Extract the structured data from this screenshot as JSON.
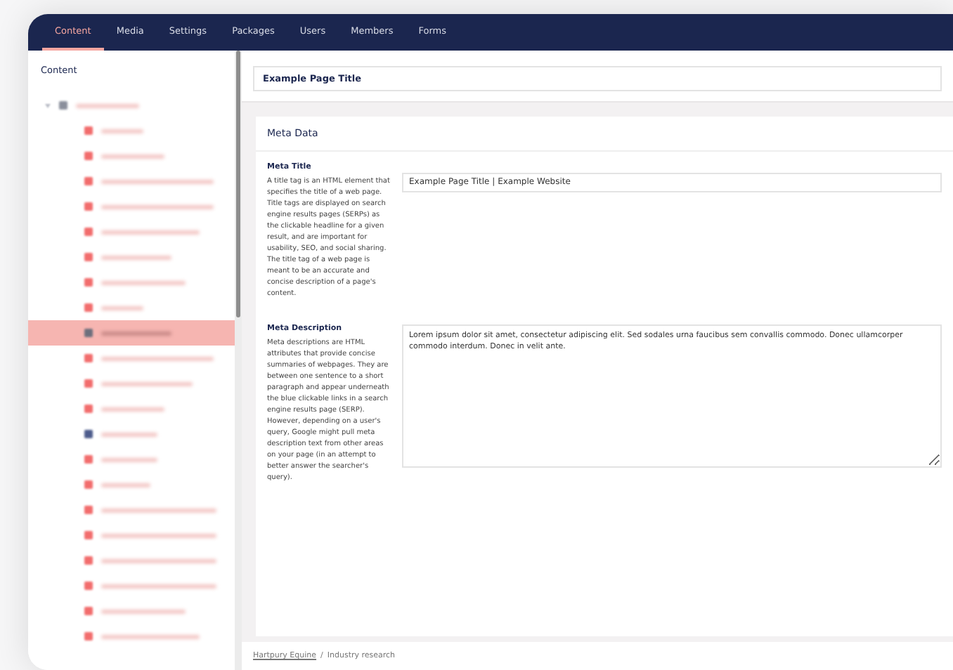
{
  "top_nav": {
    "tabs": [
      {
        "label": "Content",
        "selected": true
      },
      {
        "label": "Media",
        "selected": false
      },
      {
        "label": "Settings",
        "selected": false
      },
      {
        "label": "Packages",
        "selected": false
      },
      {
        "label": "Users",
        "selected": false
      },
      {
        "label": "Members",
        "selected": false
      },
      {
        "label": "Forms",
        "selected": false
      }
    ]
  },
  "sidebar": {
    "title": "Content",
    "root": {
      "expanded": true,
      "color": "#8a8f9c"
    },
    "items": [
      {
        "color": "#f26d6d",
        "selected": false
      },
      {
        "color": "#f26d6d",
        "selected": false
      },
      {
        "color": "#f26d6d",
        "selected": false
      },
      {
        "color": "#f26d6d",
        "selected": false
      },
      {
        "color": "#f26d6d",
        "selected": false
      },
      {
        "color": "#f26d6d",
        "selected": false
      },
      {
        "color": "#f26d6d",
        "selected": false
      },
      {
        "color": "#f26d6d",
        "selected": false
      },
      {
        "color": "#6d6f7d",
        "selected": true
      },
      {
        "color": "#f26d6d",
        "selected": false
      },
      {
        "color": "#f26d6d",
        "selected": false
      },
      {
        "color": "#f26d6d",
        "selected": false
      },
      {
        "color": "#4d5c8c",
        "selected": false
      },
      {
        "color": "#f26d6d",
        "selected": false
      },
      {
        "color": "#f26d6d",
        "selected": false
      },
      {
        "color": "#f26d6d",
        "selected": false
      },
      {
        "color": "#f26d6d",
        "selected": false
      },
      {
        "color": "#f26d6d",
        "selected": false
      },
      {
        "color": "#f26d6d",
        "selected": false
      },
      {
        "color": "#f26d6d",
        "selected": false
      },
      {
        "color": "#f26d6d",
        "selected": false
      }
    ]
  },
  "editor": {
    "page_title": "Example Page Title",
    "panel_title": "Meta Data",
    "properties": [
      {
        "kind": "input",
        "label": "Meta Title",
        "description": "A title tag is an HTML element that specifies the title of a web page. Title tags are displayed on search engine results pages (SERPs) as the clickable headline for a given result, and are important for usability, SEO, and social sharing. The title tag of a web page is meant to be an accurate and concise description of a page's content.",
        "value": "Example Page Title | Example Website"
      },
      {
        "kind": "textarea",
        "label": "Meta Description",
        "description": "Meta descriptions are HTML attributes that provide concise summaries of webpages. They are between one sentence to a short paragraph and appear underneath the blue clickable links in a search engine results page (SERP). However, depending on a user's query, Google might pull meta description text from other areas on your page (in an attempt to better answer the searcher's query).",
        "value": "Lorem ipsum dolor sit amet, consectetur adipiscing elit. Sed sodales urna faucibus sem convallis commodo. Donec ullamcorper commodo interdum. Donec in velit ante."
      }
    ]
  },
  "breadcrumb": [
    {
      "label": "Hartpury Equine",
      "kind": "link"
    },
    {
      "label": "/",
      "kind": "separator"
    },
    {
      "label": "Industry research",
      "kind": "current"
    }
  ]
}
